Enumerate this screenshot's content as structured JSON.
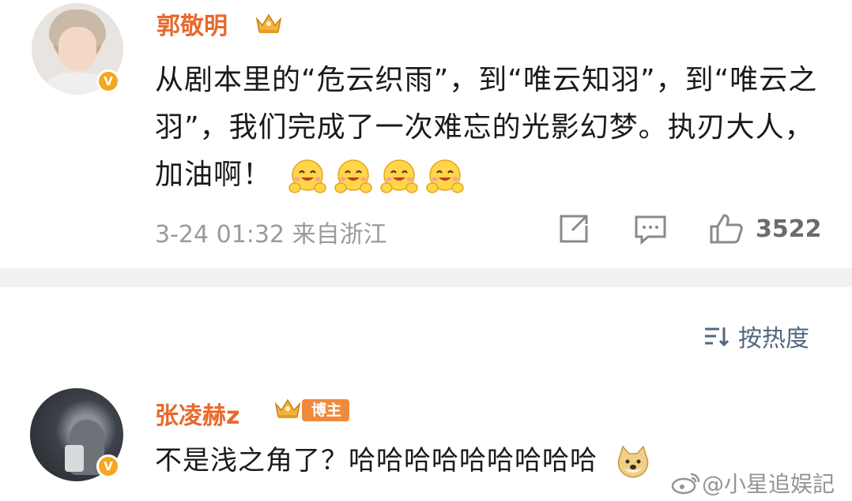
{
  "post": {
    "username": "郭敬明",
    "content": "从剧本里的“危云织雨”，到“唯云知羽”，到“唯云之羽”，我们完成了一次难忘的光影幻梦。执刃大人，加油啊！",
    "emoji_count": 4,
    "emoji": "smile-hands-emoji",
    "time": "3-24 01:32",
    "source": "来自浙江",
    "like_count": "3522",
    "verified_icon": "v-badge-icon",
    "colors": {
      "username": "#e8692b",
      "verified": "#f5a623",
      "meta": "#9a9a9a"
    }
  },
  "sort": {
    "label": "按热度",
    "icon": "sort-icon"
  },
  "comment": {
    "username": "张凌赫z",
    "tag": "博主",
    "text": "不是浅之角了？哈哈哈哈哈哈哈哈哈",
    "emoji": "doge-emoji",
    "colors": {
      "username": "#e8692b",
      "tag": "#ef8a3c"
    }
  },
  "watermark": {
    "text": "@小星追娱記"
  }
}
